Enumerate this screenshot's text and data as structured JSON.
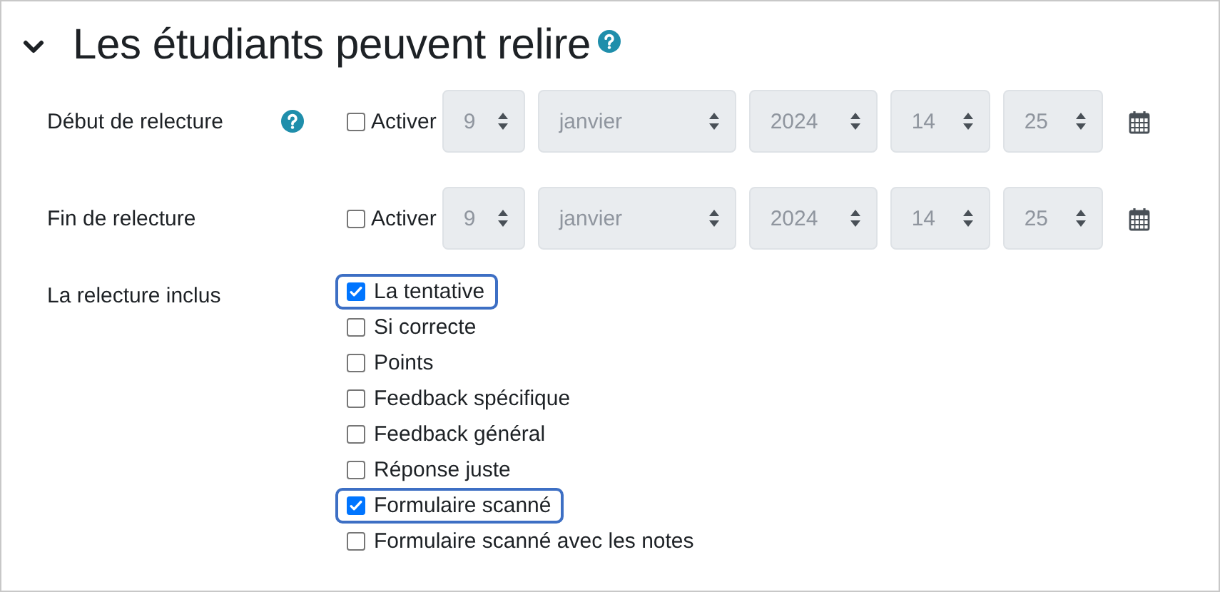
{
  "section": {
    "title": "Les étudiants peuvent relire",
    "expanded": true
  },
  "date_rows": [
    {
      "label": "Début de relecture",
      "help": true,
      "enable": {
        "label": "Activer",
        "checked": false
      },
      "fields": [
        {
          "kind": "day",
          "value": "9"
        },
        {
          "kind": "month",
          "value": "janvier"
        },
        {
          "kind": "year",
          "value": "2024"
        },
        {
          "kind": "hour",
          "value": "14"
        },
        {
          "kind": "minute",
          "value": "25"
        }
      ]
    },
    {
      "label": "Fin de relecture",
      "help": false,
      "enable": {
        "label": "Activer",
        "checked": false
      },
      "fields": [
        {
          "kind": "day",
          "value": "9"
        },
        {
          "kind": "month",
          "value": "janvier"
        },
        {
          "kind": "year",
          "value": "2024"
        },
        {
          "kind": "hour",
          "value": "14"
        },
        {
          "kind": "minute",
          "value": "25"
        }
      ]
    }
  ],
  "review_options": {
    "label": "La relecture inclus",
    "options": [
      {
        "label": "La tentative",
        "checked": true,
        "highlighted": true
      },
      {
        "label": "Si correcte",
        "checked": false,
        "highlighted": false
      },
      {
        "label": "Points",
        "checked": false,
        "highlighted": false
      },
      {
        "label": "Feedback spécifique",
        "checked": false,
        "highlighted": false
      },
      {
        "label": "Feedback général",
        "checked": false,
        "highlighted": false
      },
      {
        "label": "Réponse juste",
        "checked": false,
        "highlighted": false
      },
      {
        "label": "Formulaire scanné",
        "checked": true,
        "highlighted": true
      },
      {
        "label": "Formulaire scanné avec les notes",
        "checked": false,
        "highlighted": false
      }
    ]
  }
}
